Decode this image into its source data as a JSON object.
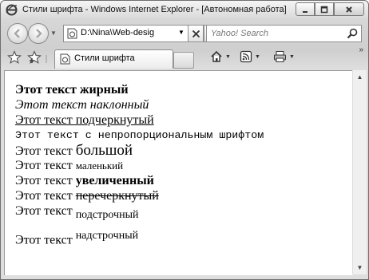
{
  "window": {
    "title": "Стили шрифта - Windows Internet Explorer - [Автономная работа]",
    "caption_buttons": [
      "minimize-icon",
      "maximize-icon",
      "close-icon"
    ]
  },
  "navigation": {
    "address": "D:\\Nina\\Web-desig",
    "search_placeholder": "Yahoo! Search"
  },
  "tabs": [
    {
      "label": "Стили шрифта"
    }
  ],
  "command_bar": {
    "icons": [
      "home-icon",
      "feeds-icon",
      "print-icon"
    ]
  },
  "page": {
    "lines": [
      {
        "text": "Этот текст жирный"
      },
      {
        "text": "Этот текст наклонный"
      },
      {
        "text": "Этот текст подчеркнутый"
      },
      {
        "text": "Этот текст с непропорциональным шрифтом"
      },
      {
        "prefix": "Этот текст ",
        "text": "большой"
      },
      {
        "prefix": "Этот текст ",
        "text": "маленький"
      },
      {
        "prefix": "Этот текст ",
        "text": "увеличенный"
      },
      {
        "prefix": "Этот текст ",
        "text": "перечеркнутый"
      },
      {
        "prefix": "Этот текст ",
        "text": "подстрочный"
      },
      {
        "prefix": "Этот текст ",
        "text": "надстрочный"
      }
    ]
  },
  "colors": {
    "window_frame": "#6f6f6f",
    "chrome": "#d7d7d7",
    "page_background": "#ffffff"
  }
}
